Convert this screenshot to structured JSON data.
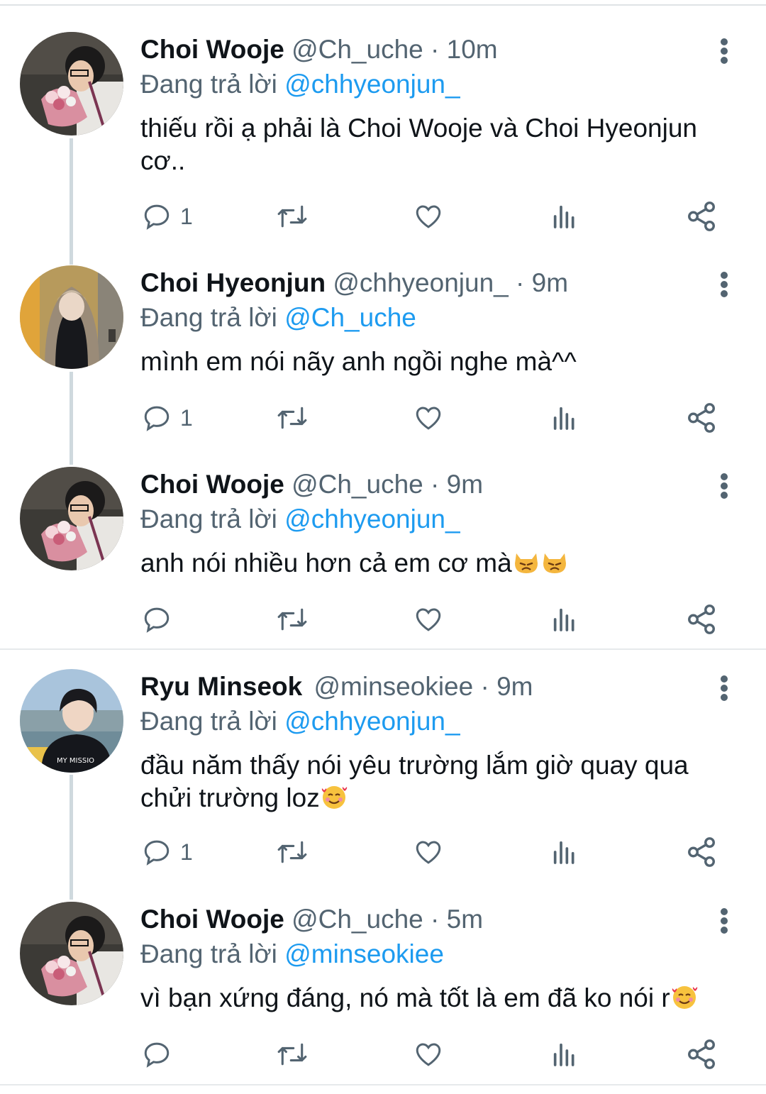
{
  "tweets": [
    {
      "name": "Choi Wooje",
      "handle": "@Ch_uche",
      "dot": "·",
      "time": "10m",
      "replying_prefix": "Đang trả lời",
      "replying_to": "@chhyeonjun_",
      "text": "thiếu rồi ạ phải là Choi Wooje và Choi Hyeonjun cơ..",
      "reply_count": "1",
      "avatar_icon": "profile-photo-flowers"
    },
    {
      "name": "Choi Hyeonjun",
      "handle": "@chhyeonjun_",
      "dot": "·",
      "time": "9m",
      "replying_prefix": "Đang trả lời",
      "replying_to": "@Ch_uche",
      "text": "mình em nói nãy anh ngồi nghe mà^^",
      "reply_count": "1",
      "avatar_icon": "profile-photo-hood"
    },
    {
      "name": "Choi Wooje",
      "handle": "@Ch_uche",
      "dot": "·",
      "time": "9m",
      "replying_prefix": "Đang trả lời",
      "replying_to": "@chhyeonjun_",
      "text": "anh nói nhiều hơn cả em cơ mà",
      "text_emoji": [
        "pouting-cat",
        "pouting-cat"
      ],
      "reply_count": "",
      "avatar_icon": "profile-photo-flowers"
    },
    {
      "name": "Ryu Minseok",
      "handle": "@minseokiee",
      "dot": "·",
      "time": "9m",
      "replying_prefix": "Đang trả lời",
      "replying_to": "@chhyeonjun_",
      "text_line1": "đầu năm thấy nói yêu trường lắm giờ quay qua",
      "text_line2": "chửi trường loz",
      "text_emoji": [
        "smiling-face-with-hearts"
      ],
      "reply_count": "1",
      "avatar_icon": "profile-photo-river"
    },
    {
      "name": "Choi Wooje",
      "handle": "@Ch_uche",
      "dot": "·",
      "time": "5m",
      "replying_prefix": "Đang trả lời",
      "replying_to": "@minseokiee",
      "text": "vì bạn xứng đáng, nó mà tốt là em đã ko nói r",
      "text_emoji": [
        "smiling-face-with-hearts"
      ],
      "reply_count": "",
      "avatar_icon": "profile-photo-flowers"
    }
  ],
  "colors": {
    "primary_text": "#0f1419",
    "secondary_text": "#536471",
    "link": "#1d9bf0",
    "thread_line": "#cfd9de"
  },
  "action_icons": [
    "reply-icon",
    "retweet-icon",
    "like-icon",
    "analytics-icon",
    "share-icon"
  ]
}
